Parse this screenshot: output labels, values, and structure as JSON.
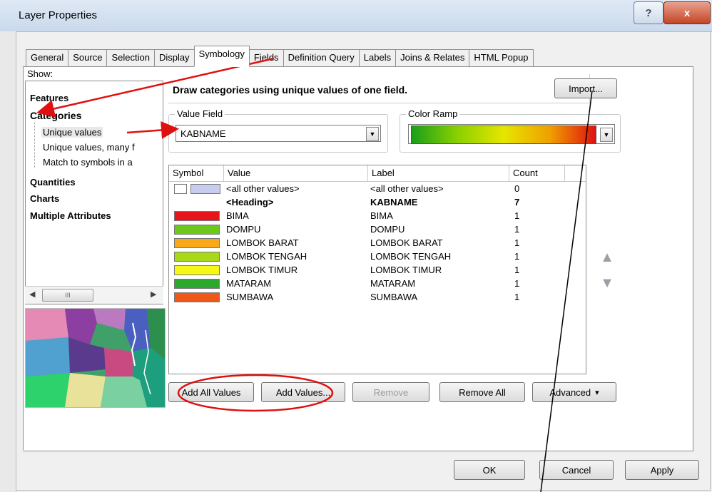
{
  "window": {
    "title": "Layer Properties",
    "help_glyph": "?",
    "close_glyph": "x"
  },
  "tabs": [
    {
      "label": "General"
    },
    {
      "label": "Source"
    },
    {
      "label": "Selection"
    },
    {
      "label": "Display"
    },
    {
      "label": "Symbology"
    },
    {
      "label": "Fields"
    },
    {
      "label": "Definition Query"
    },
    {
      "label": "Labels"
    },
    {
      "label": "Joins & Relates"
    },
    {
      "label": "HTML Popup"
    }
  ],
  "show": {
    "label": "Show:",
    "items": [
      {
        "label": "Features"
      },
      {
        "label": "Categories"
      },
      {
        "label": "Unique values"
      },
      {
        "label": "Unique values, many f"
      },
      {
        "label": "Match to symbols in a"
      },
      {
        "label": "Quantities"
      },
      {
        "label": "Charts"
      },
      {
        "label": "Multiple Attributes"
      }
    ],
    "scroll_thumb": "III"
  },
  "description": "Draw categories using unique values of one field.",
  "import_label": "Import...",
  "value_field": {
    "legend": "Value Field",
    "value": "KABNAME"
  },
  "color_ramp": {
    "legend": "Color Ramp",
    "colors": [
      "#1a9e1a",
      "#8ad100",
      "#e6e600",
      "#f0a000",
      "#e01010"
    ]
  },
  "table": {
    "headers": [
      "Symbol",
      "Value",
      "Label",
      "Count"
    ],
    "rows": [
      {
        "color": "#c8ccee",
        "value": "<all other values>",
        "label": "<all other values>",
        "count": "0",
        "bold": false
      },
      {
        "color": "",
        "value": "<Heading>",
        "label": "KABNAME",
        "count": "7",
        "bold": true
      },
      {
        "color": "#e8141c",
        "value": "BIMA",
        "label": "BIMA",
        "count": "1",
        "bold": false
      },
      {
        "color": "#6ec81a",
        "value": "DOMPU",
        "label": "DOMPU",
        "count": "1",
        "bold": false
      },
      {
        "color": "#f8a818",
        "value": "LOMBOK BARAT",
        "label": "LOMBOK BARAT",
        "count": "1",
        "bold": false
      },
      {
        "color": "#a8d81a",
        "value": "LOMBOK TENGAH",
        "label": "LOMBOK TENGAH",
        "count": "1",
        "bold": false
      },
      {
        "color": "#f8f818",
        "value": "LOMBOK TIMUR",
        "label": "LOMBOK TIMUR",
        "count": "1",
        "bold": false
      },
      {
        "color": "#2ca82c",
        "value": "MATARAM",
        "label": "MATARAM",
        "count": "1",
        "bold": false
      },
      {
        "color": "#f05818",
        "value": "SUMBAWA",
        "label": "SUMBAWA",
        "count": "1",
        "bold": false
      }
    ]
  },
  "buttons": {
    "add_all": "Add All Values",
    "add_values": "Add Values...",
    "remove": "Remove",
    "remove_all": "Remove All",
    "advanced": "Advanced",
    "advanced_caret": "▾",
    "move_up": "▲",
    "move_down": "▼",
    "ok": "OK",
    "cancel": "Cancel",
    "apply": "Apply"
  },
  "annotation_color": "#e01010"
}
